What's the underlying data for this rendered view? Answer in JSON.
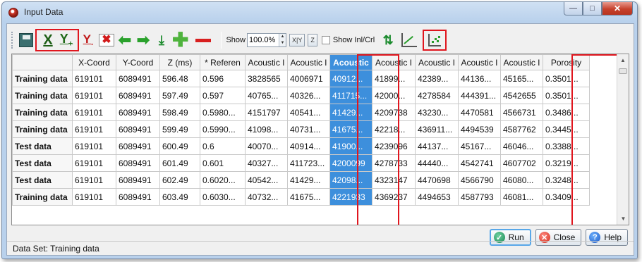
{
  "window": {
    "title": "Input Data"
  },
  "toolbar": {
    "x_label": "X",
    "yplus_label": "Y",
    "yplus_sub": "+",
    "yminus_label": "Y",
    "yminus_sub": "-",
    "show_label": "Show",
    "zoom_value": "100.0%",
    "xy_button": "X|Y",
    "z_button": "Z",
    "show_inl_label": "Show Inl/Crl"
  },
  "table": {
    "columns": [
      "",
      "X-Coord",
      "Y-Coord",
      "Z (ms)",
      "* Referen",
      "Acoustic I",
      "Acoustic I",
      "Acoustic",
      "Acoustic I",
      "Acoustic I",
      "Acoustic I",
      "Acoustic I",
      "Porosity"
    ],
    "rows": [
      [
        "Training data",
        "619101",
        "6089491",
        "596.48",
        "0.596",
        "3828565",
        "4006971",
        "40912...",
        "41899...",
        "42389...",
        "44136...",
        "45165...",
        "0.3501..."
      ],
      [
        "Training data",
        "619101",
        "6089491",
        "597.49",
        "0.597",
        "40765...",
        "40326...",
        "411715...",
        "42000...",
        "4278584",
        "444391...",
        "4542655",
        "0.3501..."
      ],
      [
        "Training data",
        "619101",
        "6089491",
        "598.49",
        "0.5980...",
        "4151797",
        "40541...",
        "41429...",
        "4209738",
        "43230...",
        "4470581",
        "4566731",
        "0.3486..."
      ],
      [
        "Training data",
        "619101",
        "6089491",
        "599.49",
        "0.5990...",
        "41098...",
        "40731...",
        "41675...",
        "42218...",
        "436911...",
        "4494539",
        "4587762",
        "0.3445..."
      ],
      [
        "Test data",
        "619101",
        "6089491",
        "600.49",
        "0.6",
        "40070...",
        "40914...",
        "41900...",
        "4239096",
        "44137...",
        "45167...",
        "46046...",
        "0.3388..."
      ],
      [
        "Test data",
        "619101",
        "6089491",
        "601.49",
        "0.601",
        "40327...",
        "411723...",
        "4200099",
        "4278733",
        "44440...",
        "4542741",
        "4607702",
        "0.3219..."
      ],
      [
        "Test data",
        "619101",
        "6089491",
        "602.49",
        "0.6020...",
        "40542...",
        "41429...",
        "42098...",
        "4323147",
        "4470698",
        "4566790",
        "46080...",
        "0.3248..."
      ],
      [
        "Training data",
        "619101",
        "6089491",
        "603.49",
        "0.6030...",
        "40732...",
        "41675...",
        "4221933",
        "4369237",
        "4494653",
        "4587793",
        "46081...",
        "0.3409..."
      ]
    ]
  },
  "buttons": {
    "run": "Run",
    "close": "Close",
    "help": "Help"
  },
  "status": {
    "text": "Data Set: Training data"
  },
  "colors": {
    "highlight": "#e0161e",
    "selection": "#3d8fdc"
  }
}
